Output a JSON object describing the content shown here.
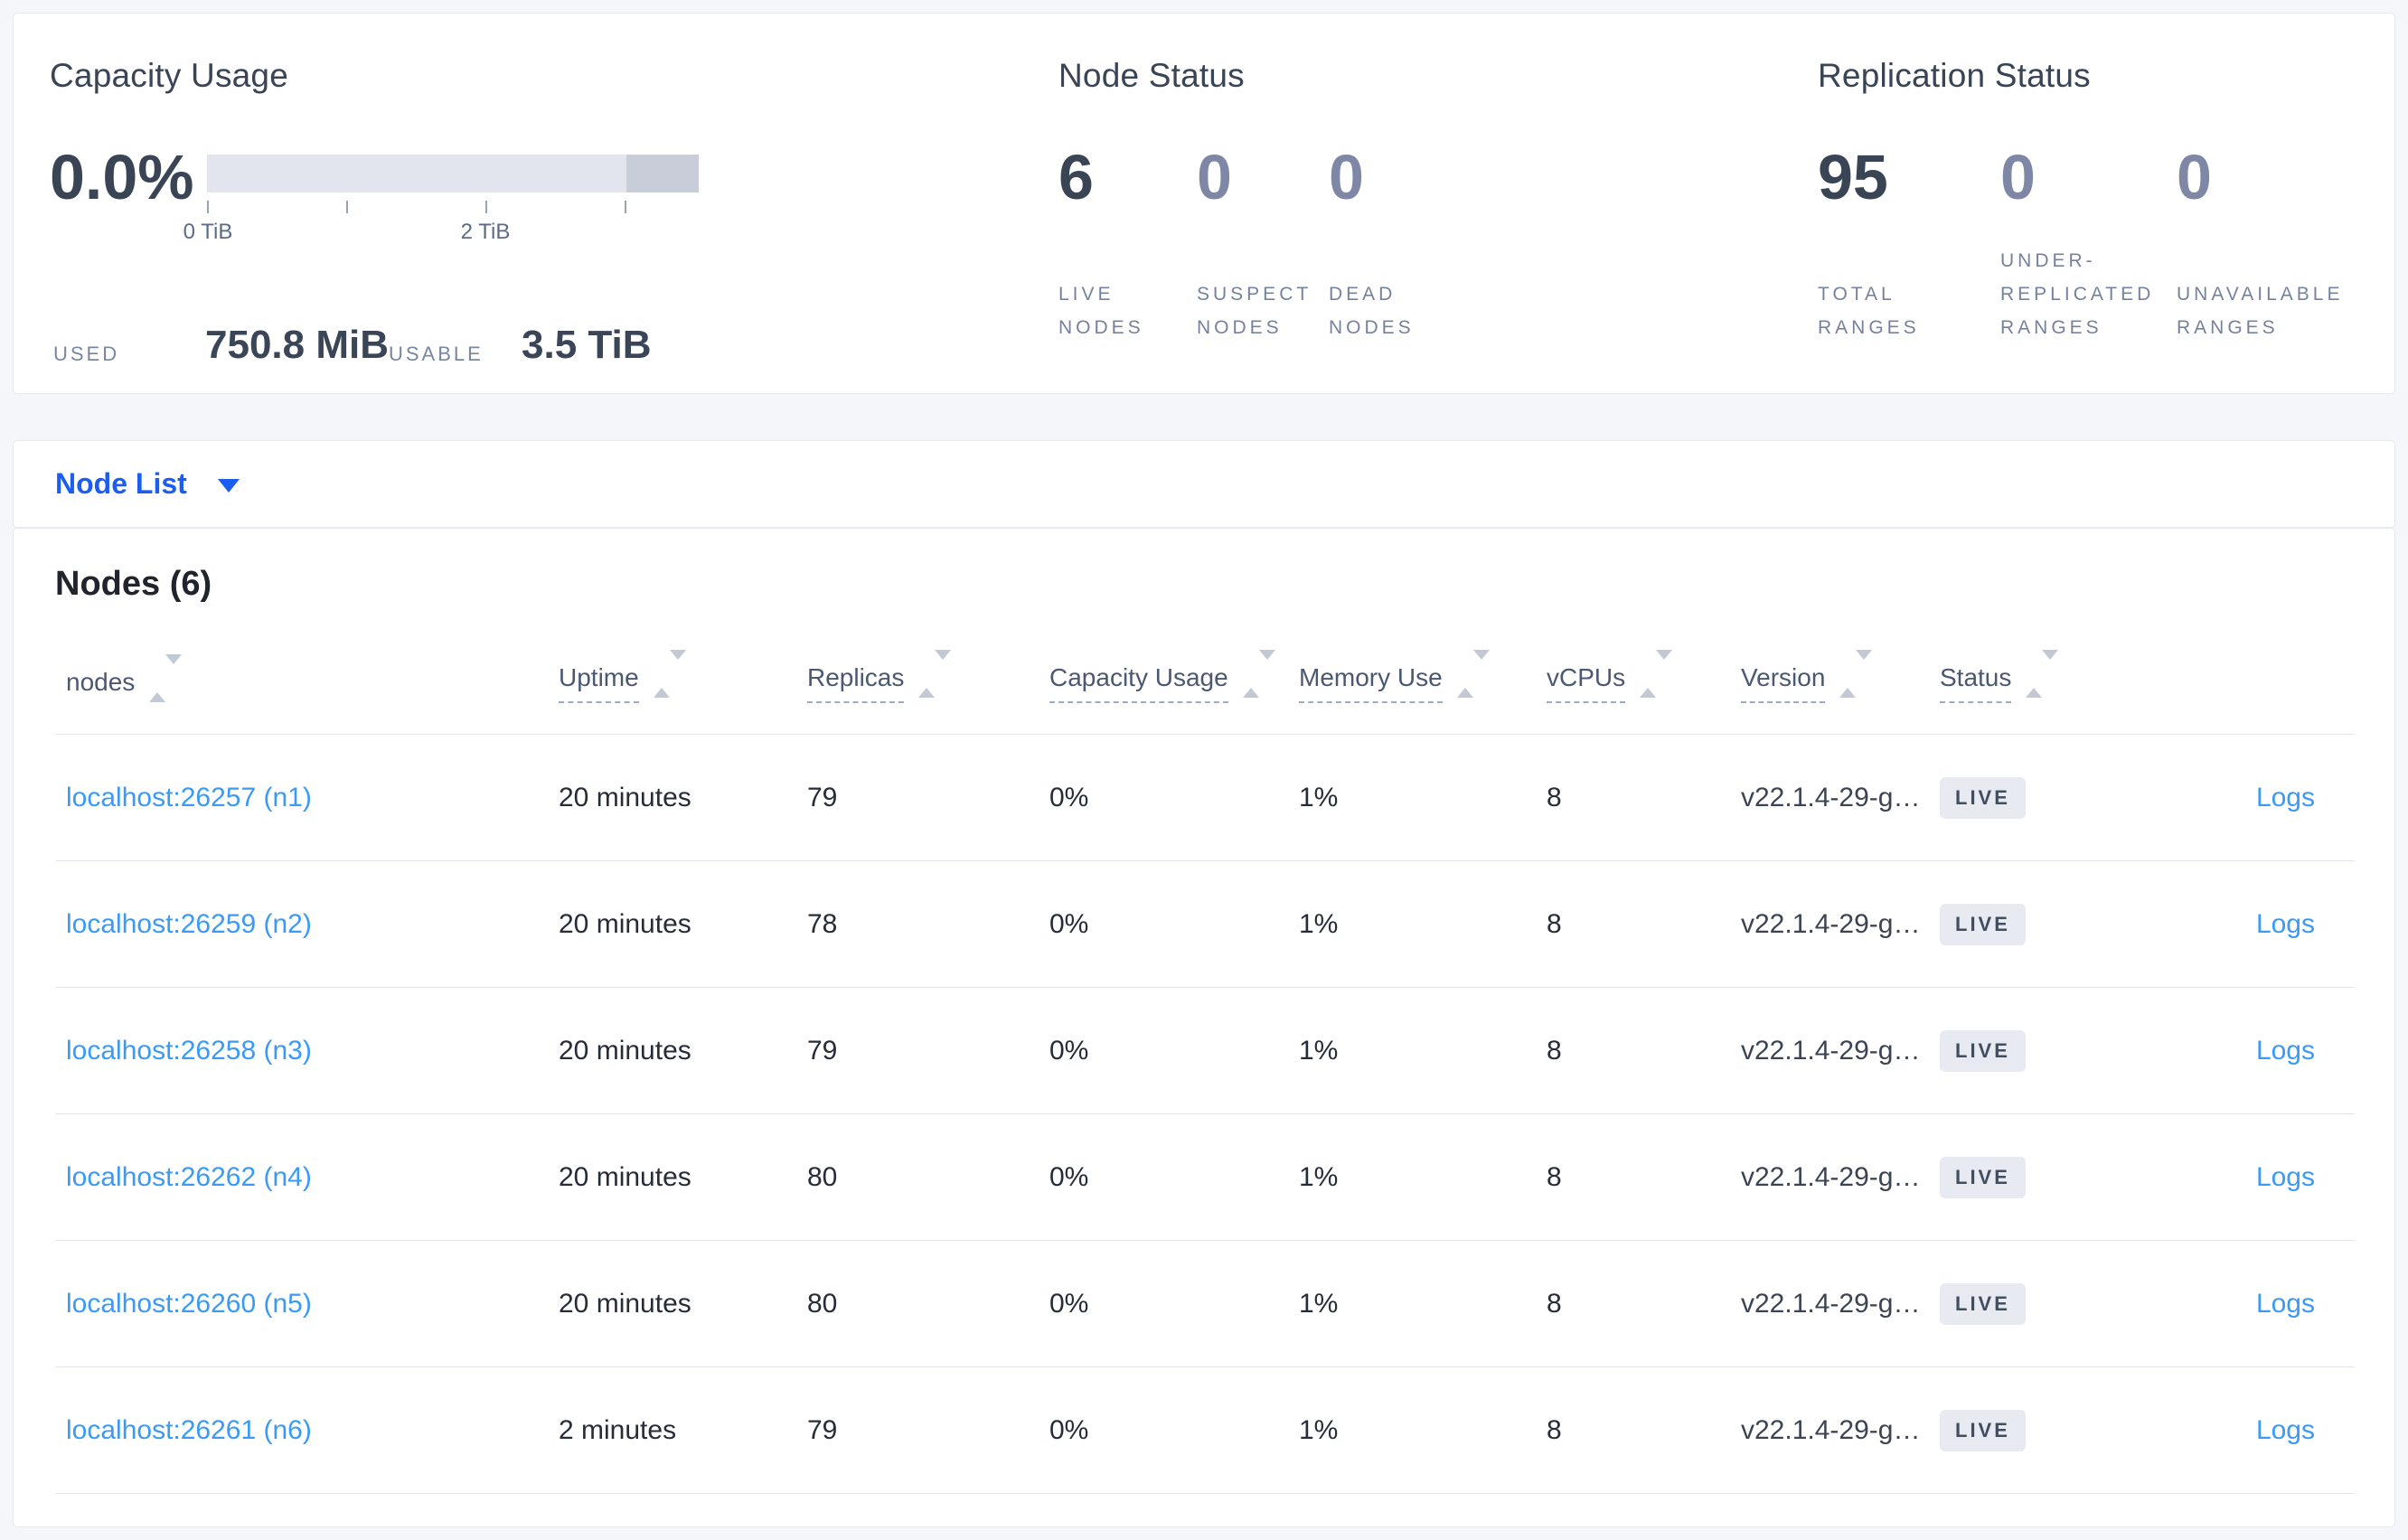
{
  "colors": {
    "page_bg": "#f4f6f9",
    "accent_blue": "#1b5df1",
    "link_blue": "#3a9af5",
    "title_slate": "#394455",
    "muted_label": "#76819e",
    "badge_bg": "#e7eaf1",
    "badge_text": "#414e61",
    "bar_light": "#e3e5ee",
    "bar_dark": "#c9cdd9"
  },
  "icons": {
    "sort": "sort-arrows-up-down",
    "view_caret": "chevron-down"
  },
  "summary": {
    "capacity": {
      "title": "Capacity Usage",
      "percent": "0.0%",
      "tick_labels": [
        "0 TiB",
        "2 TiB"
      ],
      "used_label": "USED",
      "used_value": "750.8 MiB",
      "usable_label": "USABLE",
      "usable_value": "3.5 TiB"
    },
    "node_status": {
      "title": "Node Status",
      "metrics": [
        {
          "value": "6",
          "label": "LIVE NODES"
        },
        {
          "value": "0",
          "label": "SUSPECT NODES"
        },
        {
          "value": "0",
          "label": "DEAD NODES"
        }
      ]
    },
    "replication": {
      "title": "Replication Status",
      "metrics": [
        {
          "value": "95",
          "label": "TOTAL RANGES"
        },
        {
          "value": "0",
          "label": "UNDER-REPLICATED RANGES"
        },
        {
          "value": "0",
          "label": "UNAVAILABLE RANGES"
        }
      ]
    }
  },
  "view_selector": {
    "label": "Node List"
  },
  "table": {
    "title": "Nodes (6)",
    "columns": [
      {
        "label": "nodes"
      },
      {
        "label": "Uptime"
      },
      {
        "label": "Replicas"
      },
      {
        "label": "Capacity Usage"
      },
      {
        "label": "Memory Use"
      },
      {
        "label": "vCPUs"
      },
      {
        "label": "Version"
      },
      {
        "label": "Status"
      }
    ],
    "logs_label": "Logs",
    "rows": [
      {
        "address": "localhost:26257 (n1)",
        "uptime": "20 minutes",
        "replicas": "79",
        "capacity_usage": "0%",
        "memory_use": "1%",
        "vcpus": "8",
        "version": "v22.1.4-29-g…",
        "status": "LIVE"
      },
      {
        "address": "localhost:26259 (n2)",
        "uptime": "20 minutes",
        "replicas": "78",
        "capacity_usage": "0%",
        "memory_use": "1%",
        "vcpus": "8",
        "version": "v22.1.4-29-g…",
        "status": "LIVE"
      },
      {
        "address": "localhost:26258 (n3)",
        "uptime": "20 minutes",
        "replicas": "79",
        "capacity_usage": "0%",
        "memory_use": "1%",
        "vcpus": "8",
        "version": "v22.1.4-29-g…",
        "status": "LIVE"
      },
      {
        "address": "localhost:26262 (n4)",
        "uptime": "20 minutes",
        "replicas": "80",
        "capacity_usage": "0%",
        "memory_use": "1%",
        "vcpus": "8",
        "version": "v22.1.4-29-g…",
        "status": "LIVE"
      },
      {
        "address": "localhost:26260 (n5)",
        "uptime": "20 minutes",
        "replicas": "80",
        "capacity_usage": "0%",
        "memory_use": "1%",
        "vcpus": "8",
        "version": "v22.1.4-29-g…",
        "status": "LIVE"
      },
      {
        "address": "localhost:26261 (n6)",
        "uptime": "2 minutes",
        "replicas": "79",
        "capacity_usage": "0%",
        "memory_use": "1%",
        "vcpus": "8",
        "version": "v22.1.4-29-g…",
        "status": "LIVE"
      }
    ]
  }
}
